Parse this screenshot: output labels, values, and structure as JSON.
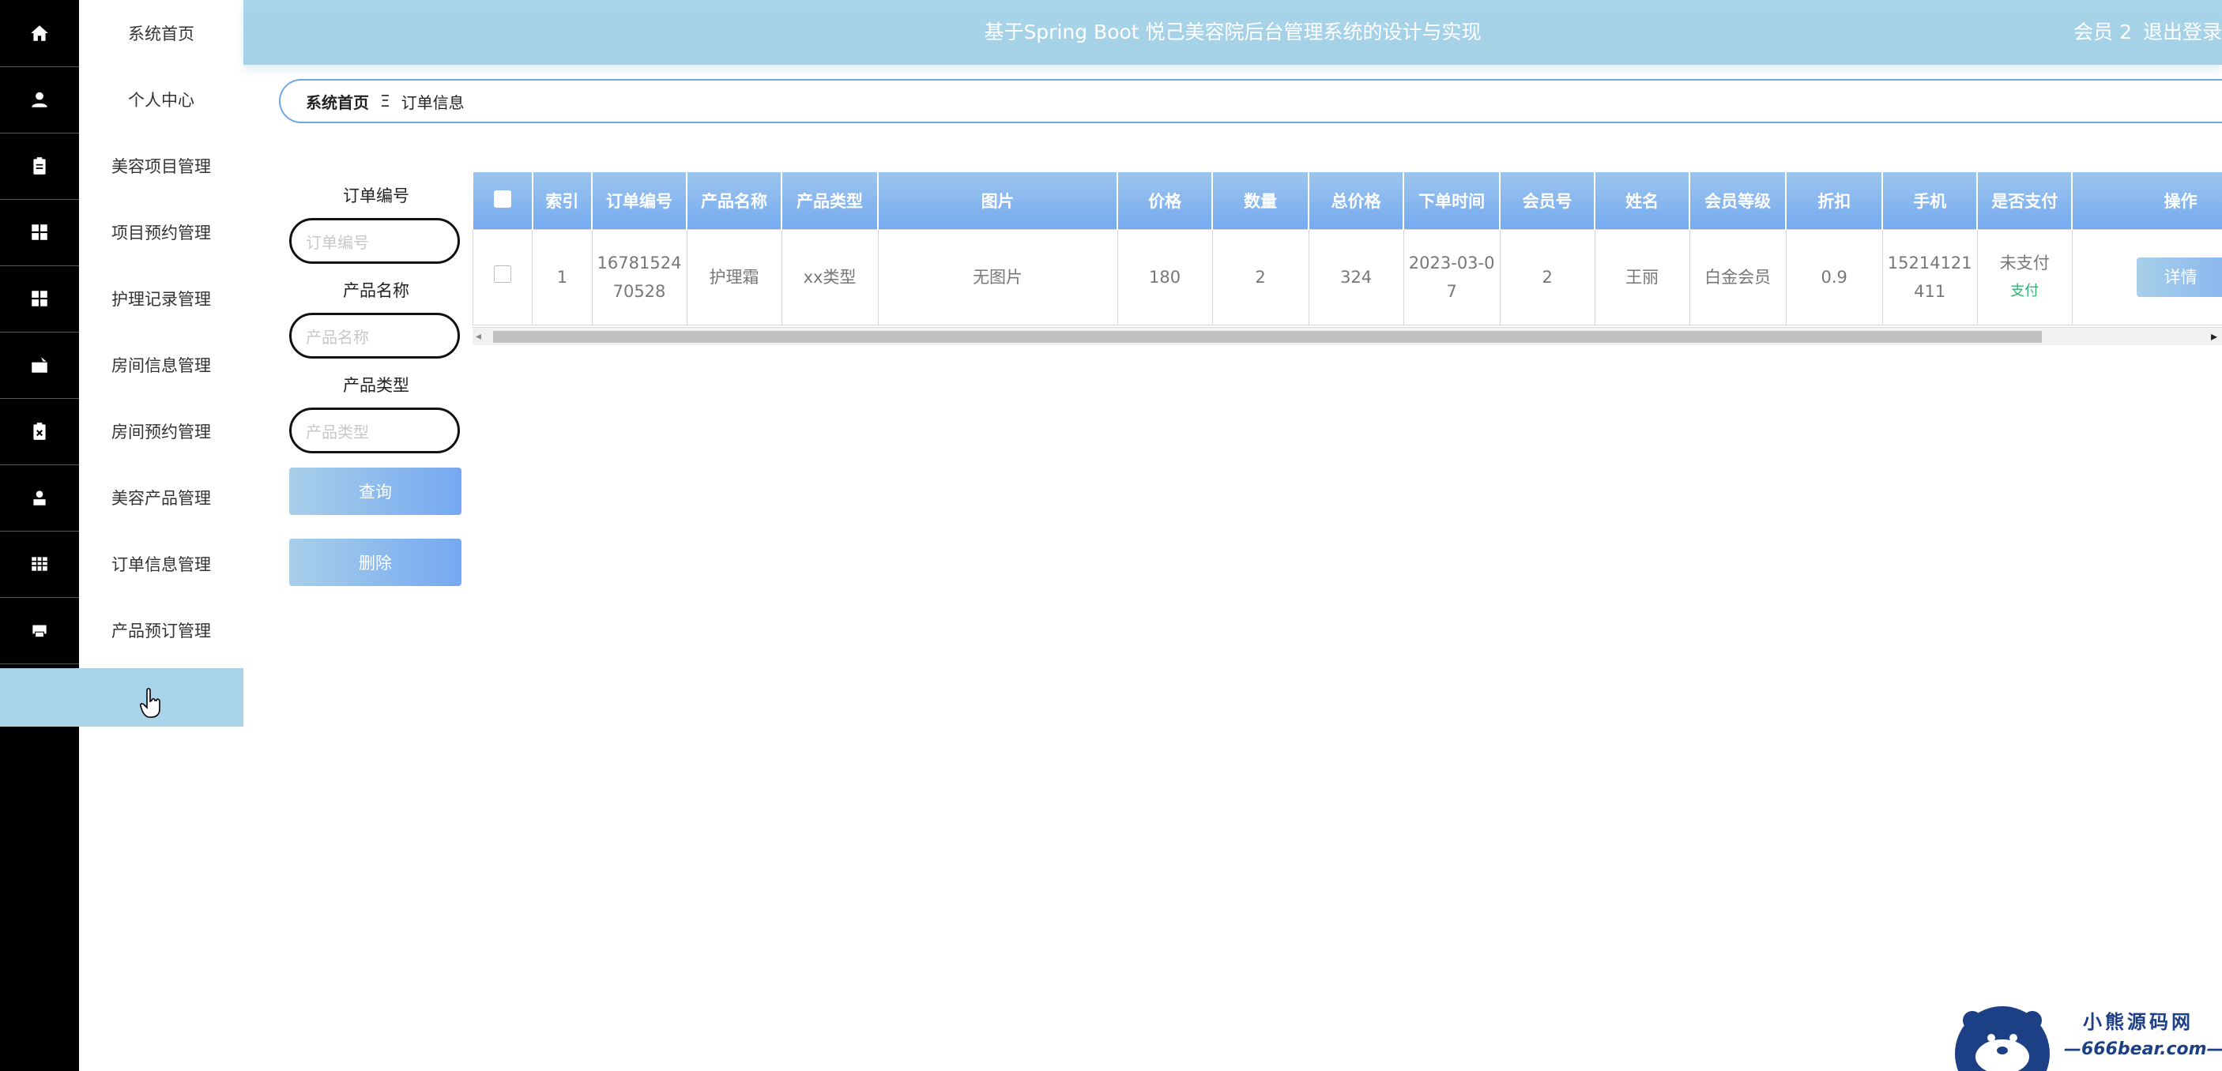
{
  "header": {
    "title": "基于Spring Boot 悦己美容院后台管理系统的设计与实现",
    "user": "会员 2",
    "logout": "退出登录"
  },
  "sidebar": {
    "items": [
      {
        "label": "系统首页",
        "icon": "home-icon"
      },
      {
        "label": "个人中心",
        "icon": "user-icon"
      },
      {
        "label": "美容项目管理",
        "icon": "clipboard-icon"
      },
      {
        "label": "项目预约管理",
        "icon": "grid-icon"
      },
      {
        "label": "护理记录管理",
        "icon": "grid-icon"
      },
      {
        "label": "房间信息管理",
        "icon": "briefcase-icon"
      },
      {
        "label": "房间预约管理",
        "icon": "clipboard-x-icon"
      },
      {
        "label": "美容产品管理",
        "icon": "person-icon"
      },
      {
        "label": "订单信息管理",
        "icon": "table-icon"
      },
      {
        "label": "产品预订管理",
        "icon": "print-icon"
      }
    ]
  },
  "breadcrumb": {
    "home": "系统首页",
    "separator": "Ξ",
    "current": "订单信息"
  },
  "search": {
    "order_no_label": "订单编号",
    "order_no_placeholder": "订单编号",
    "product_name_label": "产品名称",
    "product_name_placeholder": "产品名称",
    "product_type_label": "产品类型",
    "product_type_placeholder": "产品类型",
    "query_button": "查询",
    "delete_button": "删除"
  },
  "table": {
    "columns": [
      "索引",
      "订单编号",
      "产品名称",
      "产品类型",
      "图片",
      "价格",
      "数量",
      "总价格",
      "下单时间",
      "会员号",
      "姓名",
      "会员等级",
      "折扣",
      "手机",
      "是否支付",
      "操作"
    ],
    "rows": [
      {
        "index": "1",
        "order_no": "1678152470528",
        "product_name": "护理霜",
        "product_type": "xx类型",
        "image": "无图片",
        "price": "180",
        "quantity": "2",
        "total": "324",
        "order_time": "2023-03-07",
        "member_no": "2",
        "name": "王丽",
        "member_level": "白金会员",
        "discount": "0.9",
        "phone": "15214121411",
        "paid": "未支付",
        "pay_link": "支付",
        "detail": "详情"
      }
    ]
  },
  "colors": {
    "header_bg": "#a8d4ea",
    "table_header": "#76aaf0",
    "sidebar_rail": "#000000",
    "pay_link": "#2bb673"
  },
  "watermark": {
    "cn": "小熊源码网",
    "en": "—666bear.com—"
  }
}
